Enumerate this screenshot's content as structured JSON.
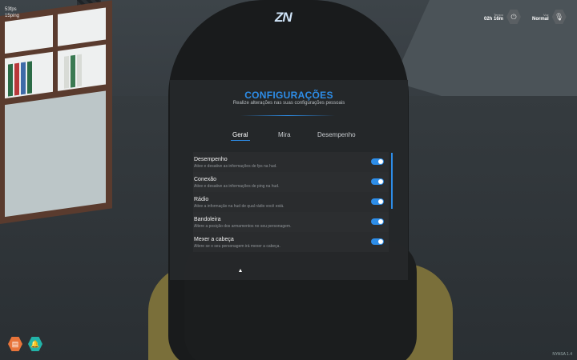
{
  "hud": {
    "fps": "53fps",
    "ping": "15ping",
    "logo": "ZN",
    "time": {
      "label": "Tempo",
      "value": "02h 16m",
      "icon": "power-icon"
    },
    "voice": {
      "label": "Voz",
      "value": "Normal",
      "icon": "microphone-icon"
    },
    "bottom_buttons": [
      {
        "icon": "briefcase-icon",
        "color": "#e8743a"
      },
      {
        "icon": "bell-icon",
        "color": "#22b3a8"
      }
    ],
    "version": "NYASA 1.4"
  },
  "settings": {
    "title": "CONFIGURAÇÕES",
    "subtitle": "Realize alterações nas suas configurações pessoais",
    "tabs": [
      {
        "label": "Geral",
        "active": true
      },
      {
        "label": "Mira",
        "active": false
      },
      {
        "label": "Desempenho",
        "active": false
      }
    ],
    "options": [
      {
        "label": "Desempenho",
        "description": "Ative e desative as informações de fps na hud.",
        "enabled": true
      },
      {
        "label": "Conexão",
        "description": "Ative e desative as informações de ping na hud.",
        "enabled": true
      },
      {
        "label": "Rádio",
        "description": "Ative a informação na hud de qual rádio você está.",
        "enabled": true
      },
      {
        "label": "Bandoleira",
        "description": "Altere a posição dos armamentos no seu personagem.",
        "enabled": true
      },
      {
        "label": "Mexer a cabeça",
        "description": "Altere se o seu personagem irá mexer a cabeça.",
        "enabled": true
      }
    ]
  },
  "colors": {
    "accent": "#2d8de8",
    "panel_bg": "#26282a"
  }
}
